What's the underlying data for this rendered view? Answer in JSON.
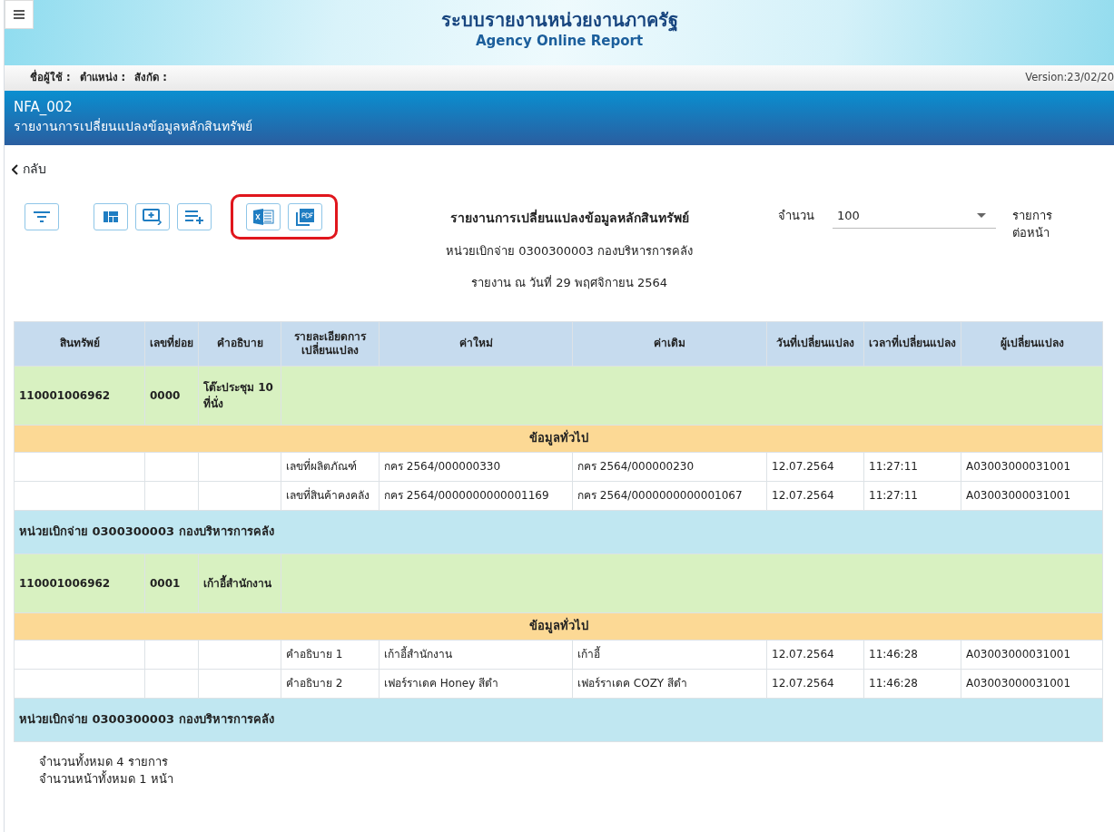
{
  "header": {
    "title": "ระบบรายงานหน่วยงานภาครัฐ",
    "subtitle": "Agency Online Report"
  },
  "user_bar": {
    "labels": [
      "ชื่อผู้ใช้ :",
      "ตำแหน่ง :",
      "สังกัด :"
    ],
    "version": "Version:23/02/20"
  },
  "title_band": {
    "code": "NFA_002",
    "name": "รายงานการเปลี่ยนแปลงข้อมูลหลักสินทรัพย์"
  },
  "back_link": "กลับ",
  "toolbar": [
    {
      "highlighted": false,
      "buttons": [
        {
          "kind": "filter"
        }
      ]
    },
    {
      "highlighted": false,
      "buttons": [
        {
          "kind": "layout"
        },
        {
          "kind": "add-screen"
        },
        {
          "kind": "add-list"
        }
      ]
    },
    {
      "highlighted": true,
      "buttons": [
        {
          "kind": "excel"
        },
        {
          "kind": "pdf"
        }
      ]
    }
  ],
  "report_heading": [
    "รายงานการเปลี่ยนแปลงข้อมูลหลักสินทรัพย์",
    "หน่วยเบิกจ่าย 0300300003 กองบริหารการคลัง",
    "รายงาน ณ วันที่ 29 พฤศจิกายน 2564"
  ],
  "page_size": {
    "label": "จำนวน",
    "value": "100",
    "suffix": "รายการต่อหน้า"
  },
  "table": {
    "columns": [
      "สินทรัพย์",
      "เลขที่ย่อย",
      "คำอธิบาย",
      "รายละเอียดการเปลี่ยนแปลง",
      "ค่าใหม่",
      "ค่าเดิม",
      "วันที่เปลี่ยนแปลง",
      "เวลาที่เปลี่ยนแปลง",
      "ผู้เปลี่ยนแปลง"
    ],
    "rows": [
      {
        "kind": "asset",
        "cells": [
          "110001006962",
          "0000",
          "โต๊ะประชุม 10 ที่นั่ง"
        ]
      },
      {
        "kind": "section",
        "text": "ข้อมูลทั่วไป"
      },
      {
        "kind": "detail",
        "cells": [
          "เลขที่ผลิตภัณฑ์",
          "กคร 2564/000000330",
          "กคร 2564/000000230",
          "12.07.2564",
          "11:27:11",
          "A03003000031001"
        ]
      },
      {
        "kind": "detail",
        "cells": [
          "เลขที่สินค้าคงคลัง",
          "กคร 2564/0000000000001169",
          "กคร 2564/0000000000001067",
          "12.07.2564",
          "11:27:11",
          "A03003000031001"
        ]
      },
      {
        "kind": "unit",
        "text": "หน่วยเบิกจ่าย 0300300003 กองบริหารการคลัง"
      },
      {
        "kind": "asset",
        "cells": [
          "110001006962",
          "0001",
          "เก้าอี้สำนักงาน"
        ]
      },
      {
        "kind": "section",
        "text": "ข้อมูลทั่วไป"
      },
      {
        "kind": "detail",
        "cells": [
          "คำอธิบาย 1",
          "เก้าอี้สำนักงาน",
          "เก้าอี้",
          "12.07.2564",
          "11:46:28",
          "A03003000031001"
        ]
      },
      {
        "kind": "detail",
        "cells": [
          "คำอธิบาย 2",
          "เฟอร์ราเดค Honey สีดำ",
          "เฟอร์ราเดค COZY สีดำ",
          "12.07.2564",
          "11:46:28",
          "A03003000031001"
        ]
      },
      {
        "kind": "unit",
        "text": "หน่วยเบิกจ่าย 0300300003 กองบริหารการคลัง"
      }
    ]
  },
  "summary": [
    "จำนวนทั้งหมด 4 รายการ",
    "จำนวนหน้าทั้งหมด 1 หน้า"
  ]
}
